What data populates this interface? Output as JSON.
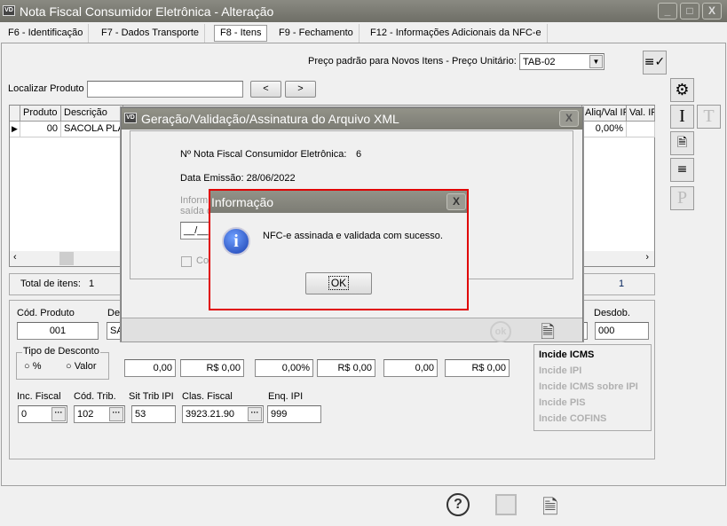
{
  "window": {
    "title": "Nota Fiscal Consumidor Eletrônica - Alteração",
    "app_icon": "VD"
  },
  "tabs": [
    {
      "label": "F6 - Identificação"
    },
    {
      "label": "F7 - Dados Transporte"
    },
    {
      "label": "F8 - Itens",
      "active": true
    },
    {
      "label": "F9 - Fechamento"
    },
    {
      "label": "F12 - Informações Adicionais da NFC-e"
    }
  ],
  "price": {
    "label": "Preço padrão para Novos Itens - Preço Unitário:",
    "value": "TAB-02"
  },
  "search": {
    "label": "Localizar Produto",
    "value": "",
    "prev": "<",
    "next": ">"
  },
  "grid": {
    "columns": [
      "Produto",
      "Descrição",
      "Aliq/Val IP",
      "Val. IP"
    ],
    "rows": [
      {
        "produto": "00",
        "descricao": "SACOLA PLÁS",
        "aliq": "0,00%",
        "val": ""
      }
    ]
  },
  "total": {
    "label": "Total de itens:",
    "value": "1",
    "right_value": "1"
  },
  "sidebar_icons": [
    "settings-gear-icon",
    "italic-I-icon",
    "document-cancel-icon",
    "list-check-icon",
    "P-icon"
  ],
  "side_T": "T",
  "form": {
    "cod_produto_label": "Cód. Produto",
    "cod_produto": "001",
    "desc_label": "Des",
    "desc_value": "SA",
    "desdob_label": "Desdob.",
    "desdob": "000",
    "tipo_desconto": {
      "label": "Tipo de Desconto",
      "options": [
        "%",
        "Valor"
      ]
    },
    "values": [
      "0,00",
      "R$ 0,00",
      "0,00%",
      "R$ 0,00",
      "0,00",
      "R$ 0,00"
    ],
    "inc_fiscal_label": "Inc. Fiscal",
    "inc_fiscal": "0",
    "cod_trib_label": "Cód. Trib.",
    "cod_trib": "102",
    "sit_trib_label": "Sit Trib IPI",
    "sit_trib": "53",
    "clas_fiscal_label": "Clas. Fiscal",
    "clas_fiscal": "3923.21.90",
    "enq_ipi_label": "Enq. IPI",
    "enq_ipi": "999",
    "incide": [
      "Incide ICMS",
      "Incide IPI",
      "Incide ICMS sobre IPI",
      "Incide PIS",
      "Incide COFINS"
    ]
  },
  "xml_dialog": {
    "title": "Geração/Validação/Assinatura do Arquivo XML",
    "nf_label": "Nº Nota Fiscal Consumidor Eletrônica:",
    "nf_value": "6",
    "data_label": "Data Emissão: 28/06/2022",
    "info_text_1": "Inform",
    "info_text_2": "saída d",
    "date_mask": "__/__",
    "checkbox_label": "Co",
    "ok": "ok"
  },
  "info_dialog": {
    "title": "Informação",
    "message": "NFC-e assinada e validada com sucesso.",
    "ok": "OK"
  }
}
